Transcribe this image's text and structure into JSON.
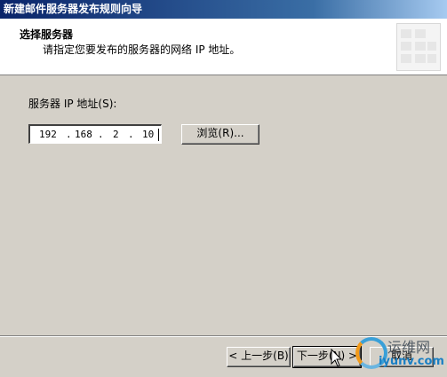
{
  "window": {
    "title": "新建邮件服务器发布规则向导"
  },
  "header": {
    "title": "选择服务器",
    "description": "请指定您要发布的服务器的网络 IP 地址。"
  },
  "form": {
    "ip_label": "服务器 IP 地址(S):",
    "ip": {
      "octet1": "192",
      "octet2": "168",
      "octet3": "2",
      "octet4": "10",
      "dot": "."
    },
    "browse_label": "浏览(R)..."
  },
  "footer": {
    "back_label": "< 上一步(B)",
    "next_label": "下一步(N) >",
    "cancel_label": "取消"
  },
  "watermark": {
    "text_cn": "运维网",
    "url": "iyunv.com"
  },
  "colors": {
    "titlebar_start": "#0a246a",
    "titlebar_end": "#a6caf0",
    "dialog_bg": "#d4d0c8"
  }
}
